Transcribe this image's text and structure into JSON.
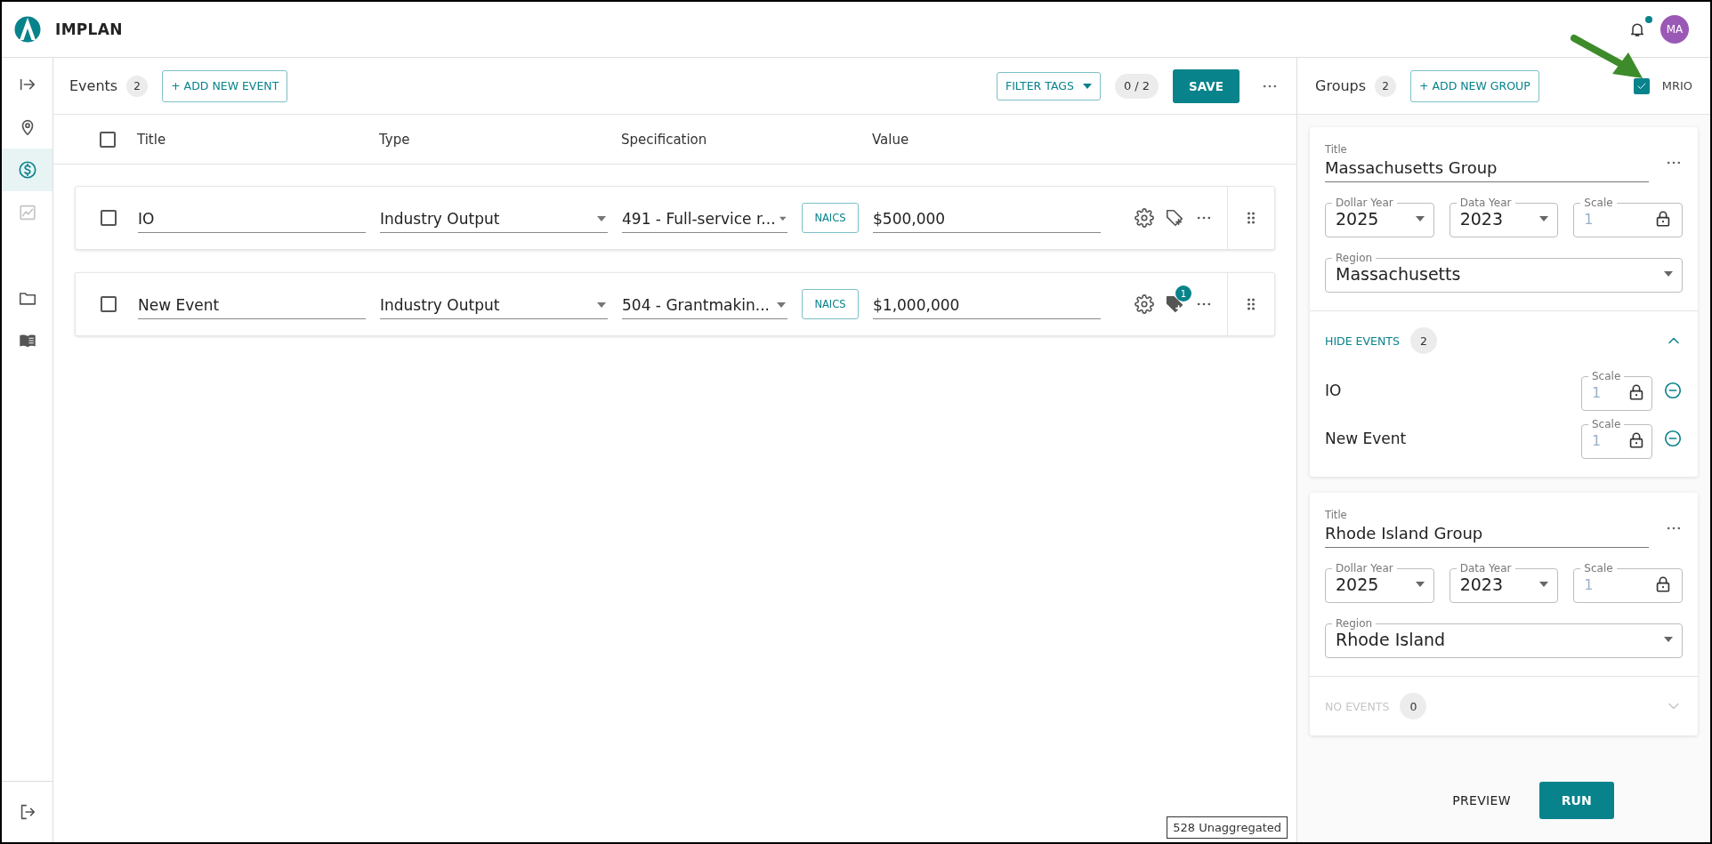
{
  "app": {
    "name": "IMPLAN",
    "avatar": "MA",
    "has_notification": true
  },
  "sidebar": {
    "groups": [
      {
        "items": [
          {
            "selected": false,
            "disabled": false
          },
          {
            "selected": false,
            "disabled": false
          },
          {
            "selected": true,
            "disabled": false
          },
          {
            "selected": false,
            "disabled": true
          }
        ]
      },
      {
        "items": [
          {
            "selected": false,
            "disabled": false
          },
          {
            "selected": false,
            "disabled": false
          }
        ]
      },
      {
        "items": [
          {
            "selected": false,
            "disabled": false
          }
        ]
      }
    ]
  },
  "events": {
    "title": "Events",
    "count": "2",
    "add_button": "+ ADD NEW EVENT",
    "filter_button": "FILTER TAGS",
    "selection_count": "0 / 2",
    "save_button": "SAVE",
    "header_checked": false,
    "columns": [
      "Title",
      "Type",
      "Specification",
      "Value"
    ],
    "rows": [
      {
        "checked": false,
        "title": "IO",
        "type": "Industry Output",
        "specification": "491 - Full-service r...",
        "code_badge": "NAICS",
        "value": "$500,000"
      },
      {
        "checked": false,
        "title": "New Event",
        "type": "Industry Output",
        "specification": "504 - Grantmakin...",
        "code_badge": "NAICS",
        "value": "$1,000,000",
        "tag_count": "1"
      }
    ],
    "status": "528 Unaggregated"
  },
  "groups_panel": {
    "title": "Groups",
    "count": "2",
    "add_button": "+ ADD NEW GROUP",
    "mrio": {
      "label": "MRIO",
      "checked": true
    },
    "groups": [
      {
        "title_label": "Title",
        "title": "Massachusetts Group",
        "fields": [
          {
            "kind": "select",
            "label": "Dollar Year",
            "value": "2025"
          },
          {
            "kind": "select",
            "label": "Data Year",
            "value": "2023"
          },
          {
            "kind": "locked",
            "label": "Scale",
            "value": "1"
          }
        ],
        "region_label": "Region",
        "region": "Massachusetts",
        "events_toggle": {
          "label": "HIDE EVENTS",
          "count": "2",
          "expanded": true,
          "disabled": false
        },
        "events": [
          {
            "name": "IO",
            "scale_label": "Scale",
            "scale": "1"
          },
          {
            "name": "New Event",
            "scale_label": "Scale",
            "scale": "1"
          }
        ]
      },
      {
        "title_label": "Title",
        "title": "Rhode Island Group",
        "fields": [
          {
            "kind": "select",
            "label": "Dollar Year",
            "value": "2025"
          },
          {
            "kind": "select",
            "label": "Data Year",
            "value": "2023"
          },
          {
            "kind": "locked",
            "label": "Scale",
            "value": "1"
          }
        ],
        "region_label": "Region",
        "region": "Rhode Island",
        "events_toggle": {
          "label": "NO EVENTS",
          "count": "0",
          "expanded": false,
          "disabled": true
        }
      }
    ],
    "preview_button": "PREVIEW",
    "run_button": "RUN"
  }
}
